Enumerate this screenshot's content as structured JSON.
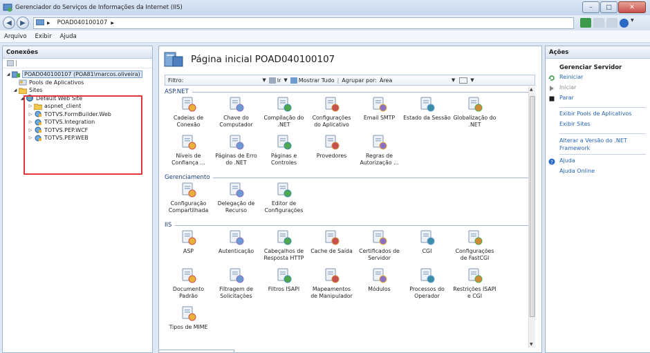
{
  "window": {
    "title": "Gerenciador do Serviços de Informações da Internet (IIS)"
  },
  "address": {
    "crumb": "POAD040100107"
  },
  "menu": [
    "Arquivo",
    "Exibir",
    "Ajuda"
  ],
  "connections": {
    "header": "Conexões",
    "server": "POAD040100107 (POA81\\marcos.oliveira)",
    "app_pools": "Pools de Aplicativos",
    "sites": "Sites",
    "default_site": "Default Web Site",
    "children": [
      "aspnet_client",
      "TOTVS.FormBuilder.Web",
      "TOTVS.Integration",
      "TOTVS.PEP.WCF",
      "TOTVS.PEP.WEB"
    ]
  },
  "main": {
    "title": "Página inicial POAD040100107",
    "filter_label": "Filtro:",
    "go_label": "Ir",
    "show_all": "Mostrar Tudo",
    "group_by": "Agrupar por:",
    "group_value": "Área",
    "sections": {
      "aspnet": {
        "title": "ASP.NET",
        "items": [
          "Cadeias de\nConexão",
          "Chave do\nComputador",
          "Compilação do\n.NET",
          "Configurações\ndo Aplicativo",
          "Email SMTP",
          "Estado da Sessão",
          "Globalização do\n.NET",
          "Níveis de\nConfiança ...",
          "Páginas de Erro\ndo .NET",
          "Páginas e\nControles",
          "Provedores",
          "Regras de\nAutorização ..."
        ]
      },
      "mgmt": {
        "title": "Gerenciamento",
        "items": [
          "Configuração\nCompartilhada",
          "Delegação de\nRecurso",
          "Editor de\nConfigurações"
        ]
      },
      "iis": {
        "title": "IIS",
        "items": [
          "ASP",
          "Autenticação",
          "Cabeçalhos de\nResposta HTTP",
          "Cache de Saída",
          "Certificados de\nServidor",
          "CGI",
          "Configurações\nde FastCGI",
          "Documento\nPadrão",
          "Filtragem de\nSolicitações",
          "Filtros ISAPI",
          "Mapeamentos\nde Manipulador",
          "Módulos",
          "Processos do\nOperador",
          "Restrições ISAPI\ne CGI",
          "Tipos de MIME"
        ]
      }
    }
  },
  "actions": {
    "header": "Ações",
    "group": "Gerenciar Servidor",
    "restart": "Reiniciar",
    "start": "Iniciar",
    "stop": "Parar",
    "view_pools": "Exibir Pools de Aplicativos",
    "view_sites": "Exibir Sites",
    "change_net": "Alterar a Versão do .NET Framework",
    "help": "Ajuda",
    "help_online": "Ajuda Online"
  },
  "colors": {
    "accent": "#2463b9",
    "section": "#1a3e7c",
    "highlight_box": "#e0353b"
  }
}
